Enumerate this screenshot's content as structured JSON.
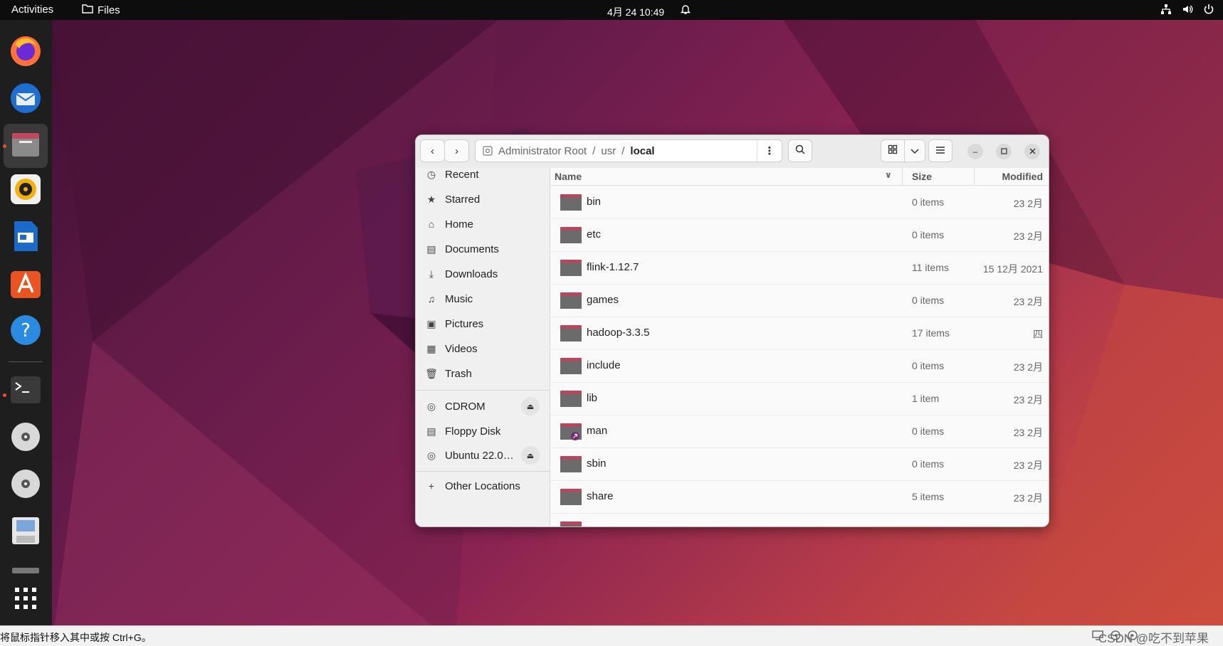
{
  "topbar": {
    "activities": "Activities",
    "app_name": "Files",
    "clock": "4月 24  10:49"
  },
  "statusline": {
    "hint": "将鼠标指针移入其中或按 Ctrl+G。",
    "watermark": "CSDN @吃不到苹果"
  },
  "window": {
    "path": [
      "Administrator Root",
      "usr",
      "local"
    ]
  },
  "sidebar": {
    "places": [
      {
        "label": "Recent",
        "icon": "clock-icon"
      },
      {
        "label": "Starred",
        "icon": "star-icon"
      },
      {
        "label": "Home",
        "icon": "home-icon"
      },
      {
        "label": "Documents",
        "icon": "document-icon"
      },
      {
        "label": "Downloads",
        "icon": "download-icon"
      },
      {
        "label": "Music",
        "icon": "music-icon"
      },
      {
        "label": "Pictures",
        "icon": "picture-icon"
      },
      {
        "label": "Videos",
        "icon": "video-icon"
      },
      {
        "label": "Trash",
        "icon": "trash-icon"
      }
    ],
    "devices": [
      {
        "label": "CDROM",
        "icon": "disc-icon",
        "eject": true
      },
      {
        "label": "Floppy Disk",
        "icon": "floppy-icon",
        "eject": false
      },
      {
        "label": "Ubuntu 22.0…",
        "icon": "disc-icon",
        "eject": true
      }
    ],
    "other": "Other Locations"
  },
  "columns": {
    "name": "Name",
    "size": "Size",
    "modified": "Modified"
  },
  "files": [
    {
      "name": "bin",
      "size": "0 items",
      "modified": "23 2月"
    },
    {
      "name": "etc",
      "size": "0 items",
      "modified": "23 2月"
    },
    {
      "name": "flink-1.12.7",
      "size": "11 items",
      "modified": "15 12月 2021"
    },
    {
      "name": "games",
      "size": "0 items",
      "modified": "23 2月"
    },
    {
      "name": "hadoop-3.3.5",
      "size": "17 items",
      "modified": "四"
    },
    {
      "name": "include",
      "size": "0 items",
      "modified": "23 2月"
    },
    {
      "name": "lib",
      "size": "1 item",
      "modified": "23 2月"
    },
    {
      "name": "man",
      "size": "0 items",
      "modified": "23 2月",
      "link": true
    },
    {
      "name": "sbin",
      "size": "0 items",
      "modified": "23 2月"
    },
    {
      "name": "share",
      "size": "5 items",
      "modified": "23 2月"
    }
  ],
  "colors": {
    "accent": "#e95420",
    "folder": "#6b6b6b",
    "folder_tab": "#b5475e"
  }
}
